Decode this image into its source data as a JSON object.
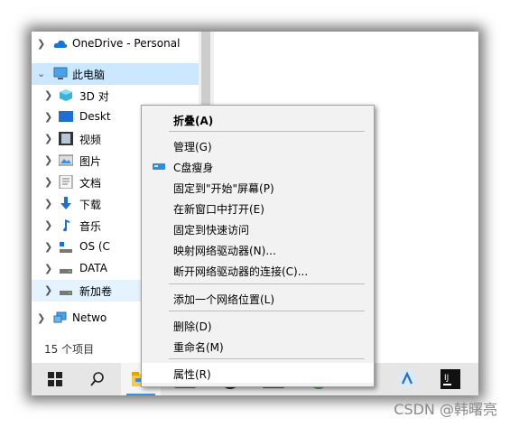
{
  "sidebar": {
    "items": [
      {
        "label": "OneDrive - Personal",
        "icon": "cloud-icon"
      },
      {
        "label": "此电脑",
        "icon": "computer-icon"
      },
      {
        "label": "3D 对",
        "icon": "3d-objects-icon"
      },
      {
        "label": "Deskt",
        "icon": "desktop-icon"
      },
      {
        "label": "视频",
        "icon": "video-icon"
      },
      {
        "label": "图片",
        "icon": "pictures-icon"
      },
      {
        "label": "文档",
        "icon": "documents-icon"
      },
      {
        "label": "下载",
        "icon": "download-icon"
      },
      {
        "label": "音乐",
        "icon": "music-icon"
      },
      {
        "label": "OS (C",
        "icon": "os-drive-icon"
      },
      {
        "label": "DATA",
        "icon": "drive-icon"
      },
      {
        "label": "新加卷",
        "icon": "drive-icon"
      },
      {
        "label": "Netwo",
        "icon": "network-icon"
      }
    ]
  },
  "status": {
    "item_count": "15 个项目"
  },
  "context_menu": {
    "items": [
      {
        "label": "折叠(A)"
      },
      {
        "label": "管理(G)"
      },
      {
        "label": "C盘瘦身",
        "icon": "disk-cleanup-icon"
      },
      {
        "label": "固定到\"开始\"屏幕(P)"
      },
      {
        "label": "在新窗口中打开(E)"
      },
      {
        "label": "固定到快速访问"
      },
      {
        "label": "映射网络驱动器(N)..."
      },
      {
        "label": "断开网络驱动器的连接(C)..."
      },
      {
        "label": "添加一个网络位置(L)"
      },
      {
        "label": "删除(D)"
      },
      {
        "label": "重命名(M)"
      },
      {
        "label": "属性(R)"
      }
    ]
  },
  "taskbar": {
    "items": [
      "windows-start-icon",
      "search-icon",
      "file-explorer-icon",
      "chart-app-icon",
      "media-app-icon",
      "terminal-icon",
      "color-app-icon",
      "android-studio-icon",
      "app-icon",
      "intellij-icon"
    ]
  },
  "watermark": "CSDN @韩曙亮"
}
